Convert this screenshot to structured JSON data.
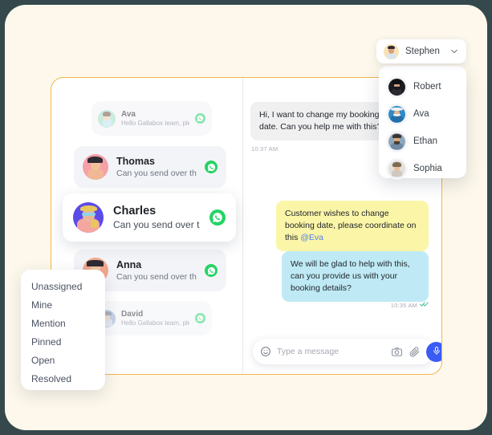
{
  "theme": {
    "page_bg": "#FDF8EB",
    "card_border": "#F2B64C",
    "accent_blue": "#3B5BF5",
    "whatsapp_green": "#25D366",
    "note_yellow": "#FBF5A8",
    "outgoing_blue": "#BFEAF5",
    "incoming_grey": "#F0F0F1",
    "mention_blue": "#4E7FE8"
  },
  "user_chip": {
    "name": "Stephen",
    "avatar_icon": "avatar-stephen",
    "chevron_icon": "chevron-down-icon"
  },
  "user_dropdown": {
    "items": [
      {
        "name": "Robert",
        "avatar_icon": "avatar-robert"
      },
      {
        "name": "Ava",
        "avatar_icon": "avatar-ava"
      },
      {
        "name": "Ethan",
        "avatar_icon": "avatar-ethan"
      },
      {
        "name": "Sophia",
        "avatar_icon": "avatar-sophia"
      }
    ]
  },
  "conversations": [
    {
      "name": "Ava",
      "snippet": "Hello Gallabox team, pleas..",
      "channel_icon": "whatsapp-icon",
      "avatar_icon": "avatar-ava-list",
      "active": false
    },
    {
      "name": "Thomas",
      "snippet": "Can you send over tha..",
      "channel_icon": "whatsapp-icon",
      "avatar_icon": "avatar-thomas",
      "active": false
    },
    {
      "name": "Charles",
      "snippet": "Can you send over tha..",
      "channel_icon": "whatsapp-icon",
      "avatar_icon": "avatar-charles",
      "active": true
    },
    {
      "name": "Anna",
      "snippet": "Can you send over tha..",
      "channel_icon": "whatsapp-icon",
      "avatar_icon": "avatar-anna",
      "active": false
    },
    {
      "name": "David",
      "snippet": "Hello Gallabox team, pleas..",
      "channel_icon": "whatsapp-icon",
      "avatar_icon": "avatar-david",
      "active": false
    }
  ],
  "filter_menu": {
    "items": [
      "Unassigned",
      "Mine",
      "Mention",
      "Pinned",
      "Open",
      "Resolved"
    ]
  },
  "chat": {
    "incoming": {
      "text": "Hi, I want to change my booking date. Can you help me with this?",
      "time": "10:37 AM"
    },
    "note": {
      "text_before": "Customer wishes to change booking date, please coordinate on this ",
      "mention": "@Eva"
    },
    "outgoing": {
      "text": "We will be glad to help with this, can you provide us with your booking details?",
      "time": "10:35 AM",
      "status_icon": "double-check-icon"
    }
  },
  "composer": {
    "placeholder": "Type a message",
    "value": "",
    "emoji_icon": "emoji-smiley-icon",
    "camera_icon": "camera-icon",
    "attach_icon": "paperclip-icon",
    "mic_icon": "microphone-icon"
  }
}
